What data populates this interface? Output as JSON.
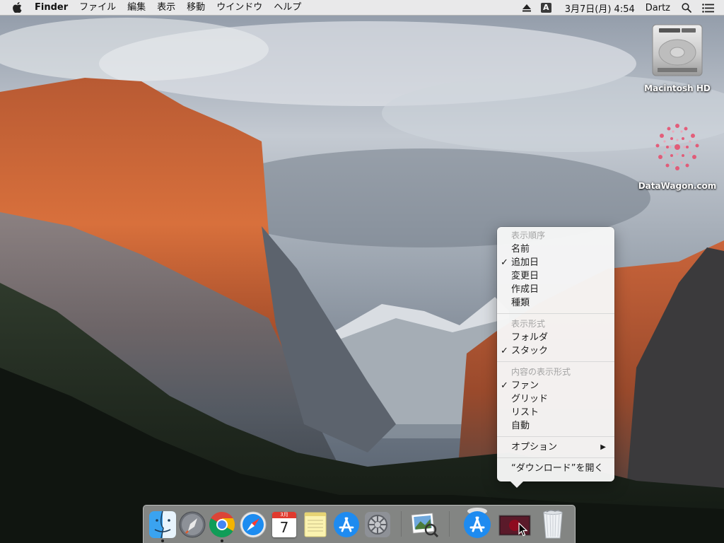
{
  "menubar": {
    "app_name": "Finder",
    "menus": [
      "ファイル",
      "編集",
      "表示",
      "移動",
      "ウインドウ",
      "ヘルプ"
    ],
    "input_source": "A",
    "clock": "3月7日(月) 4:54",
    "user": "Dartz"
  },
  "desktop": {
    "icons": [
      {
        "label": "Macintosh HD"
      },
      {
        "label": "DataWagon.com"
      }
    ]
  },
  "context_menu": {
    "sections": [
      {
        "header": "表示順序",
        "items": [
          {
            "label": "名前",
            "checked": false
          },
          {
            "label": "追加日",
            "checked": true
          },
          {
            "label": "変更日",
            "checked": false
          },
          {
            "label": "作成日",
            "checked": false
          },
          {
            "label": "種類",
            "checked": false
          }
        ]
      },
      {
        "header": "表示形式",
        "items": [
          {
            "label": "フォルダ",
            "checked": false
          },
          {
            "label": "スタック",
            "checked": true
          }
        ]
      },
      {
        "header": "内容の表示形式",
        "items": [
          {
            "label": "ファン",
            "checked": true
          },
          {
            "label": "グリッド",
            "checked": false
          },
          {
            "label": "リスト",
            "checked": false
          },
          {
            "label": "自動",
            "checked": false
          }
        ]
      }
    ],
    "options_label": "オプション",
    "open_label": "“ダウンロード”を開く",
    "check_mark": "✓",
    "submenu_arrow": "▶"
  },
  "dock": {
    "apps": [
      {
        "name": "finder-icon",
        "running": true
      },
      {
        "name": "launchpad-icon",
        "running": false
      },
      {
        "name": "chrome-icon",
        "running": true
      },
      {
        "name": "safari-icon",
        "running": false
      },
      {
        "name": "calendar-icon",
        "running": false
      },
      {
        "name": "notes-icon",
        "running": false
      },
      {
        "name": "app-store-icon",
        "running": false
      },
      {
        "name": "system-preferences-icon",
        "running": false
      },
      {
        "name": "preview-icon",
        "running": false
      },
      {
        "name": "app-store-download-icon",
        "running": false
      },
      {
        "name": "downloads-stack-icon",
        "running": false
      },
      {
        "name": "trash-icon",
        "running": false
      }
    ],
    "calendar_month": "3月",
    "calendar_day": "7"
  }
}
